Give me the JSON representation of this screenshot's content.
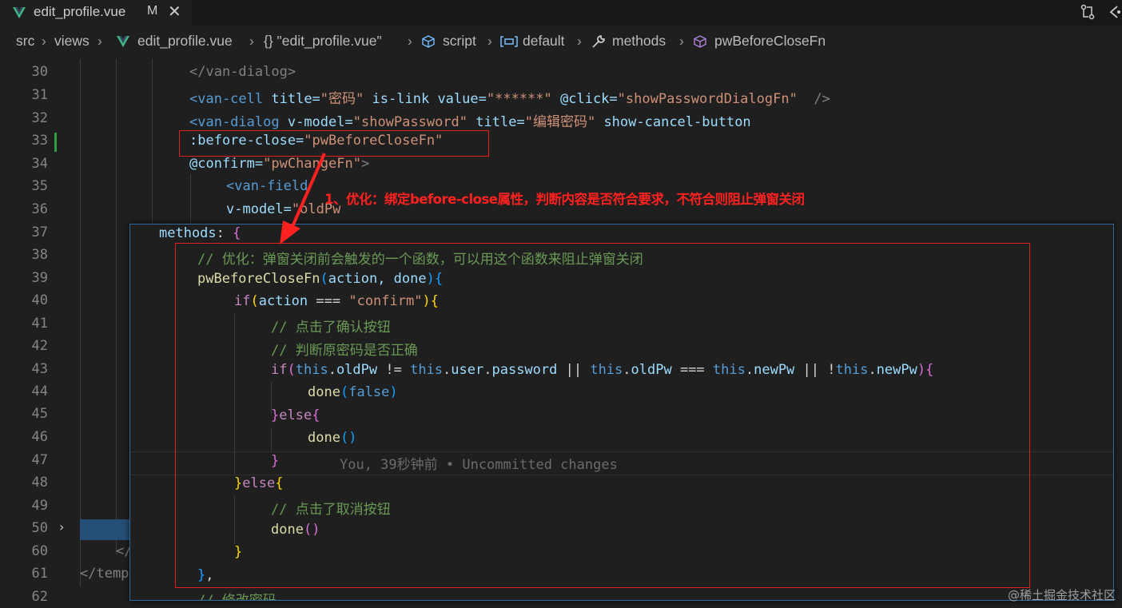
{
  "tab": {
    "title": "edit_profile.vue",
    "modified": "M",
    "close": "✕"
  },
  "breadcrumb": [
    "src",
    "views",
    "edit_profile.vue",
    "{} \"edit_profile.vue\"",
    "script",
    "default",
    "methods",
    "pwBeforeCloseFn"
  ],
  "gutter": [
    "30",
    "31",
    "32",
    "33",
    "34",
    "35",
    "36",
    "37",
    "38",
    "39",
    "40",
    "41",
    "42",
    "43",
    "44",
    "45",
    "46",
    "47",
    "48",
    "49",
    "50",
    "60",
    "61",
    "62"
  ],
  "code": {
    "l30": "</van-dialog>",
    "l31_tag": "<van-cell",
    "l31_title_attr": "title=",
    "l31_title_val": "\"密码\"",
    "l31_islink": "is-link",
    "l31_value_attr": "value=",
    "l31_value_val": "\"******\"",
    "l31_click_attr": "@click=",
    "l31_click_val": "\"showPasswordDialogFn\"",
    "l31_end": "/>",
    "l32_tag": "<van-dialog",
    "l32_model_attr": "v-model=",
    "l32_model_val": "\"showPassword\"",
    "l32_title_attr": "title=",
    "l32_title_val": "\"编辑密码\"",
    "l32_cancel": "show-cancel-button",
    "l33_attr": ":before-close=",
    "l33_val": "\"pwBeforeCloseFn\"",
    "l34_attr": "@confirm=",
    "l34_val": "\"pwChangeFn\"",
    "l34_end": ">",
    "l35": "<van-field",
    "l36_attr": "v-model=",
    "l36_val": "\"oldPw",
    "l37_methods": "methods",
    "l37_colon": ": ",
    "l37_brace": "{",
    "l38": "// 优化：弹窗关闭前会触发的一个函数，可以用这个函数来阻止弹窗关闭",
    "l39_fn": "pwBeforeCloseFn",
    "l39_args": "action, done",
    "l40_if": "if",
    "l40_cond_a": "action",
    "l40_op": " === ",
    "l40_str": "\"confirm\"",
    "l41": "// 点击了确认按钮",
    "l42": "// 判断原密码是否正确",
    "l43_if": "if",
    "l43_this": "this",
    "l43_oldpw": "oldPw",
    "l43_user": "user",
    "l43_password": "password",
    "l43_newpw": "newPw",
    "l44_done": "done",
    "l44_false": "false",
    "l45_else": "else",
    "l46_done": "done",
    "l47_blame": "You, 39秒钟前 • Uncommitted changes",
    "l48_else": "else",
    "l49": "// 点击了取消按钮",
    "l50_done": "done",
    "l61": "</temp",
    "l60": "</",
    "l62": "// 修改密码"
  },
  "annotation": "1、优化：绑定before-close属性，判断内容是否符合要求，不符合则阻止弹窗关闭",
  "watermark": "@稀土掘金技术社区",
  "colors": {
    "background": "#1f1f1f",
    "annotation_red": "#ff2020",
    "hover_border": "#2e6a9e"
  },
  "icons": [
    "vue-icon",
    "git-compare-icon",
    "go-back-icon",
    "braces-icon",
    "cube-icon",
    "symbol-variable-icon",
    "wrench-icon",
    "method-icon"
  ]
}
